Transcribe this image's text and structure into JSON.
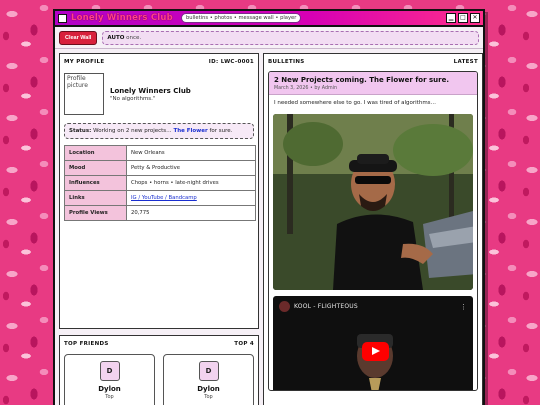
{
  "window": {
    "title": "Lonely Winners Club",
    "nav": "bulletins • photos • message wall • player",
    "controls": [
      "▁",
      "□",
      "✕"
    ]
  },
  "toolbar": {
    "clear_wall": "Clear Wall",
    "ticker_label": "AUTO",
    "ticker_text": "once."
  },
  "profile": {
    "header": "MY PROFILE",
    "id": "ID: LWC-0001",
    "pic_alt": "Profile picture",
    "name": "Lonely Winners Club",
    "quote": "\"No algorithms.\"",
    "status_label": "Status:",
    "status_text": "Working on 2 new projects…",
    "status_link": "The Flower",
    "status_tail": "for sure.",
    "rows": [
      {
        "key": "Location",
        "value": "New Orleans"
      },
      {
        "key": "Mood",
        "value": "Petty & Productive"
      },
      {
        "key": "Influences",
        "value": "Chops • horns • late-night drives"
      },
      {
        "key": "Links",
        "value": "IG / YouTube / Bandcamp"
      },
      {
        "key": "Profile Views",
        "value": "20,775"
      }
    ]
  },
  "friends": {
    "header": "TOP FRIENDS",
    "count": "TOP 4",
    "items": [
      {
        "initial": "D",
        "name": "Dylon",
        "rank": "Top"
      },
      {
        "initial": "D",
        "name": "Dylon",
        "rank": "Top"
      }
    ]
  },
  "bulletins": {
    "header": "BULLETINS",
    "sort": "LATEST",
    "post": {
      "title": "2 New Projects coming. The Flower for sure.",
      "meta": "March 3, 2026 • by Admin",
      "body": "I needed somewhere else to go. I was tired of algorithms…",
      "video_title": "KOOL - FLIGHTEOUS"
    }
  },
  "colors": {
    "accent": "#d700b4",
    "link": "#1a2fd0",
    "table_key_bg": "#f3c3dc",
    "clear_button": "#d8203c"
  }
}
